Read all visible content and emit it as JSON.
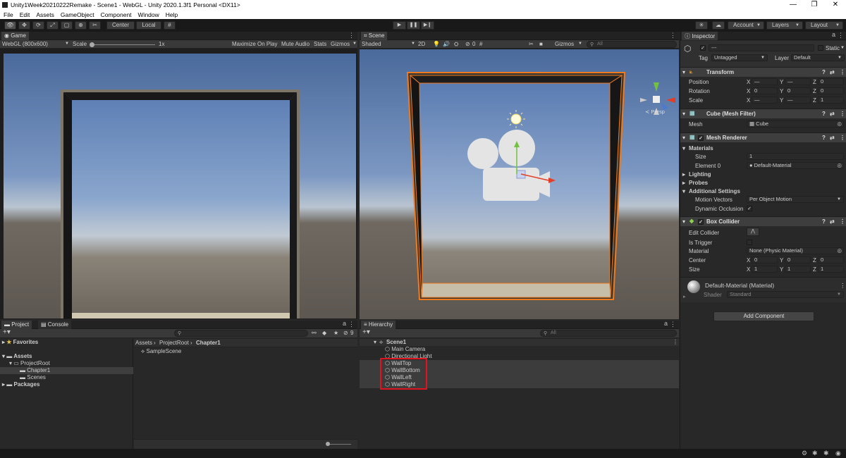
{
  "window": {
    "title": "Unity1Week20210222Remake - Scene1 - WebGL - Unity 2020.1.3f1 Personal <DX11>"
  },
  "menu": [
    "File",
    "Edit",
    "Assets",
    "GameObject",
    "Component",
    "Window",
    "Help"
  ],
  "toolbar": {
    "pivot": "Center",
    "space": "Local",
    "account": "Account",
    "layers": "Layers",
    "layout": "Layout"
  },
  "game": {
    "tab": "Game",
    "resolution": "WebGL (800x600)",
    "scale_label": "Scale",
    "scale_value": "1x",
    "maximize": "Maximize On Play",
    "mute": "Mute Audio",
    "stats": "Stats",
    "gizmos": "Gizmos"
  },
  "scene": {
    "tab": "Scene",
    "shading": "Shaded",
    "mode2d": "2D",
    "hidden_count": "0",
    "gizmos": "Gizmos",
    "search_placeholder": "All",
    "persp": "≺ Persp"
  },
  "project": {
    "tab": "Project",
    "console_tab": "Console",
    "filter_count": "9",
    "favorites": "Favorites",
    "tree": {
      "assets": "Assets",
      "project_root": "ProjectRoot",
      "chapter1": "Chapter1",
      "scenes": "Scenes",
      "packages": "Packages"
    },
    "breadcrumb": [
      "Assets",
      "ProjectRoot",
      "Chapter1"
    ],
    "files": [
      "SampleScene"
    ]
  },
  "hierarchy": {
    "tab": "Hierarchy",
    "search_placeholder": "All",
    "scene": "Scene1",
    "items": [
      "Main Camera",
      "Directional Light",
      "WallTop",
      "WallBottom",
      "WallLeft",
      "WallRight"
    ]
  },
  "inspector": {
    "tab": "Inspector",
    "name": "---",
    "static": "Static",
    "tag_label": "Tag",
    "tag_value": "Untagged",
    "layer_label": "Layer",
    "layer_value": "Default",
    "transform": {
      "title": "Transform",
      "position_label": "Position",
      "rotation_label": "Rotation",
      "scale_label": "Scale",
      "position": [
        "—",
        "—",
        "0"
      ],
      "rotation": [
        "0",
        "0",
        "0"
      ],
      "scale": [
        "—",
        "—",
        "1"
      ]
    },
    "mesh_filter": {
      "title": "Cube (Mesh Filter)",
      "mesh_label": "Mesh",
      "mesh_value": "Cube"
    },
    "mesh_renderer": {
      "title": "Mesh Renderer",
      "materials": "Materials",
      "size_label": "Size",
      "size_value": "1",
      "element_label": "Element 0",
      "element_value": "Default-Material",
      "lighting": "Lighting",
      "probes": "Probes",
      "additional": "Additional Settings",
      "motion_label": "Motion Vectors",
      "motion_value": "Per Object Motion",
      "occlusion_label": "Dynamic Occlusion"
    },
    "box_collider": {
      "title": "Box Collider",
      "edit_label": "Edit Collider",
      "trigger_label": "Is Trigger",
      "material_label": "Material",
      "material_value": "None (Physic Material)",
      "center_label": "Center",
      "size_label": "Size",
      "center": [
        "0",
        "0",
        "0"
      ],
      "size": [
        "1",
        "1",
        "1"
      ]
    },
    "material": {
      "name": "Default-Material (Material)",
      "shader_label": "Shader",
      "shader_value": "Standard"
    },
    "add_component": "Add Component"
  },
  "colors": {
    "highlight": "#e0141e",
    "selection_outline": "#f07a1e",
    "accent_blue": "#2c5d87"
  }
}
